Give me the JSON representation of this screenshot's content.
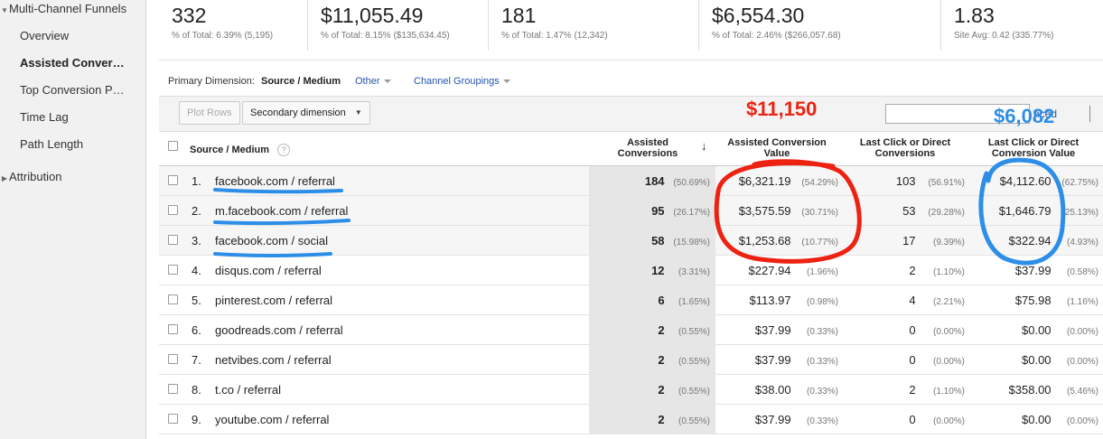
{
  "sidebar": {
    "multi_channel": "Multi-Channel Funnels",
    "items": [
      {
        "label": "Overview",
        "active": false
      },
      {
        "label": "Assisted Conver…",
        "active": true
      },
      {
        "label": "Top Conversion P…",
        "active": false
      },
      {
        "label": "Time Lag",
        "active": false
      },
      {
        "label": "Path Length",
        "active": false
      }
    ],
    "attribution": "Attribution"
  },
  "summary": [
    {
      "value": "332",
      "prefix": "% of Total:",
      "pct": "6.39%",
      "rest": "(5,195)"
    },
    {
      "value": "$11,055.49",
      "prefix": "% of Total:",
      "pct": "8.15%",
      "rest": "($135,634.45)"
    },
    {
      "value": "181",
      "prefix": "% of Total:",
      "pct": "1.47%",
      "rest": "(12,342)"
    },
    {
      "value": "$6,554.30",
      "prefix": "% of Total:",
      "pct": "2.46%",
      "rest": "($266,057.68)"
    },
    {
      "value": "1.83",
      "prefix": "Site Avg:",
      "pct": "0.42",
      "rest": "(335.77%)"
    }
  ],
  "dimension": {
    "label": "Primary Dimension:",
    "active": "Source / Medium",
    "other": "Other",
    "channel_groupings": "Channel Groupings"
  },
  "toolbar": {
    "plot_rows": "Plot Rows",
    "secondary": "Secondary dimension",
    "advanced": "nced"
  },
  "table": {
    "headers": {
      "source": "Source / Medium",
      "assisted_conv_1": "Assisted",
      "assisted_conv_2": "Conversions",
      "assisted_val_1": "Assisted Conversion",
      "assisted_val_2": "Value",
      "last_conv_1": "Last Click or Direct",
      "last_conv_2": "Conversions",
      "last_val_1": "Last Click or Direct",
      "last_val_2": "Conversion Value"
    },
    "rows": [
      {
        "idx": "1.",
        "source": "facebook.com / referral",
        "ac": "184",
        "ac_pct": "(50.69%)",
        "av": "$6,321.19",
        "av_pct": "(54.29%)",
        "lc": "103",
        "lc_pct": "(56.91%)",
        "lv": "$4,112.60",
        "lv_pct": "(62.75%)"
      },
      {
        "idx": "2.",
        "source": "m.facebook.com / referral",
        "ac": "95",
        "ac_pct": "(26.17%)",
        "av": "$3,575.59",
        "av_pct": "(30.71%)",
        "lc": "53",
        "lc_pct": "(29.28%)",
        "lv": "$1,646.79",
        "lv_pct": "(25.13%)"
      },
      {
        "idx": "3.",
        "source": "facebook.com / social",
        "ac": "58",
        "ac_pct": "(15.98%)",
        "av": "$1,253.68",
        "av_pct": "(10.77%)",
        "lc": "17",
        "lc_pct": "(9.39%)",
        "lv": "$322.94",
        "lv_pct": "(4.93%)"
      },
      {
        "idx": "4.",
        "source": "disqus.com / referral",
        "ac": "12",
        "ac_pct": "(3.31%)",
        "av": "$227.94",
        "av_pct": "(1.96%)",
        "lc": "2",
        "lc_pct": "(1.10%)",
        "lv": "$37.99",
        "lv_pct": "(0.58%)"
      },
      {
        "idx": "5.",
        "source": "pinterest.com / referral",
        "ac": "6",
        "ac_pct": "(1.65%)",
        "av": "$113.97",
        "av_pct": "(0.98%)",
        "lc": "4",
        "lc_pct": "(2.21%)",
        "lv": "$75.98",
        "lv_pct": "(1.16%)"
      },
      {
        "idx": "6.",
        "source": "goodreads.com / referral",
        "ac": "2",
        "ac_pct": "(0.55%)",
        "av": "$37.99",
        "av_pct": "(0.33%)",
        "lc": "0",
        "lc_pct": "(0.00%)",
        "lv": "$0.00",
        "lv_pct": "(0.00%)"
      },
      {
        "idx": "7.",
        "source": "netvibes.com / referral",
        "ac": "2",
        "ac_pct": "(0.55%)",
        "av": "$37.99",
        "av_pct": "(0.33%)",
        "lc": "0",
        "lc_pct": "(0.00%)",
        "lv": "$0.00",
        "lv_pct": "(0.00%)"
      },
      {
        "idx": "8.",
        "source": "t.co / referral",
        "ac": "2",
        "ac_pct": "(0.55%)",
        "av": "$38.00",
        "av_pct": "(0.33%)",
        "lc": "2",
        "lc_pct": "(1.10%)",
        "lv": "$358.00",
        "lv_pct": "(5.46%)"
      },
      {
        "idx": "9.",
        "source": "youtube.com / referral",
        "ac": "2",
        "ac_pct": "(0.55%)",
        "av": "$37.99",
        "av_pct": "(0.33%)",
        "lc": "0",
        "lc_pct": "(0.00%)",
        "lv": "$0.00",
        "lv_pct": "(0.00%)"
      }
    ]
  },
  "annotations": {
    "red_total": "$11,150",
    "blue_total": "$6,082",
    "red_color": "#ee2211",
    "blue_color": "#2d8ee8"
  }
}
